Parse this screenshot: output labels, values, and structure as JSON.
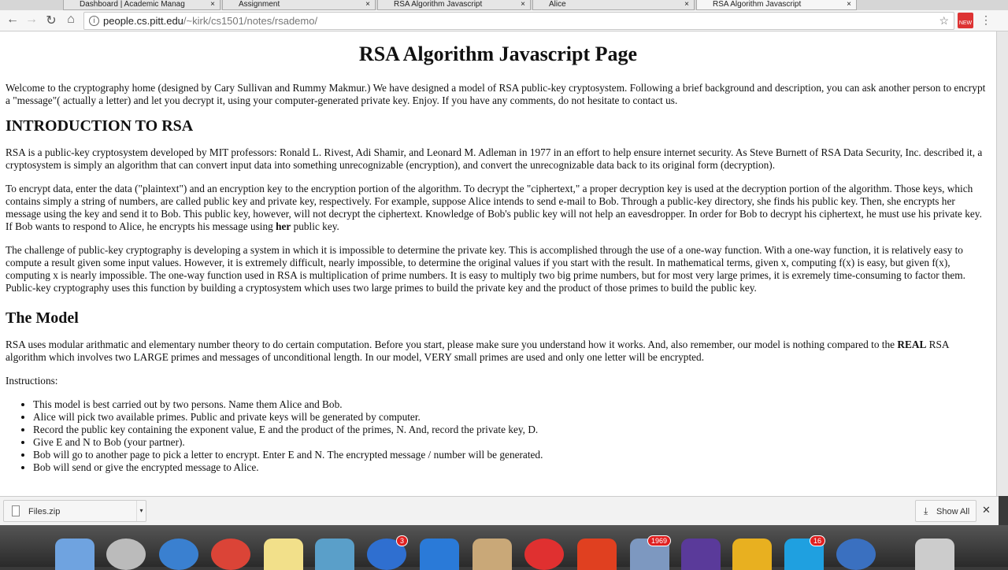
{
  "tabs": [
    {
      "label": "Dashboard | Academic Manag"
    },
    {
      "label": "Assignment"
    },
    {
      "label": "RSA Algorithm Javascript"
    },
    {
      "label": "Alice"
    },
    {
      "label": "RSA Algorithm Javascript",
      "active": true
    }
  ],
  "address": {
    "host": "people.cs.pitt.edu",
    "path": "/~kirk/cs1501/notes/rsademo/"
  },
  "ext_badge": "NEW",
  "page": {
    "title": "RSA Algorithm Javascript Page",
    "intro": "Welcome to the cryptography home (designed by Cary Sullivan and Rummy Makmur.) We have designed a model of RSA public-key cryptosystem. Following a brief background and description, you can ask another person to encrypt a \"message\"( actually a letter) and let you decrypt it, using your computer-generated private key. Enjoy. If you have any comments, do not hesitate to contact us.",
    "h_intro": "INTRODUCTION TO RSA",
    "p1": "RSA is a public-key cryptosystem developed by MIT professors: Ronald L. Rivest, Adi Shamir, and Leonard M. Adleman in 1977 in an effort to help ensure internet security. As Steve Burnett of RSA Data Security, Inc. described it, a cryptosystem is simply an algorithm that can convert input data into something unrecognizable (encryption), and convert the unrecognizable data back to its original form (decryption).",
    "p2a": "To encrypt data, enter the data (\"plaintext\") and an encryption key to the encryption portion of the algorithm. To decrypt the \"ciphertext,\" a proper decryption key is used at the decryption portion of the algorithm. Those keys, which contains simply a string of numbers, are called public key and private key, respectively. For example, suppose Alice intends to send e-mail to Bob. Through a public-key directory, she finds his public key. Then, she encrypts her message using the key and send it to Bob. This public key, however, will not decrypt the ciphertext. Knowledge of Bob's public key will not help an eavesdropper. In order for Bob to decrypt his ciphertext, he must use his private key. If Bob wants to respond to Alice, he encrypts his message using ",
    "p2b": "her",
    "p2c": " public key.",
    "p3": "The challenge of public-key cryptography is developing a system in which it is impossible to determine the private key. This is accomplished through the use of a one-way function. With a one-way function, it is relatively easy to compute a result given some input values. However, it is extremely difficult, nearly impossible, to determine the original values if you start with the result. In mathematical terms, given x, computing f(x) is easy, but given f(x), computing x is nearly impossible. The one-way function used in RSA is multiplication of prime numbers. It is easy to multiply two big prime numbers, but for most very large primes, it is exremely time-consuming to factor them. Public-key cryptography uses this function by building a cryptosystem which uses two large primes to build the private key and the product of those primes to build the public key.",
    "h_model": "The Model",
    "p4a": "RSA uses modular arithmatic and elementary number theory to do certain computation. Before you start, please make sure you understand how it works. And, also remember, our model is nothing compared to the ",
    "p4b": "REAL",
    "p4c": " RSA algorithm which involves two LARGE primes and messages of unconditional length. In our model, VERY small primes are used and only one letter will be encrypted.",
    "instr": "Instructions:",
    "steps": [
      "This model is best carried out by two persons. Name them Alice and Bob.",
      "Alice will pick two available primes. Public and private keys will be generated by computer.",
      "Record the public key containing the exponent value, E and the product of the primes, N. And, record the private key, D.",
      "Give E and N to Bob (your partner).",
      "Bob will go to another page to pick a letter to encrypt. Enter E and N. The encrypted message / number will be generated.",
      "Bob will send or give the encrypted message to Alice."
    ]
  },
  "downloads": {
    "file": "Files.zip",
    "show_all": "Show All"
  },
  "dock": {
    "badges": [
      "3",
      "1969",
      "16"
    ]
  }
}
